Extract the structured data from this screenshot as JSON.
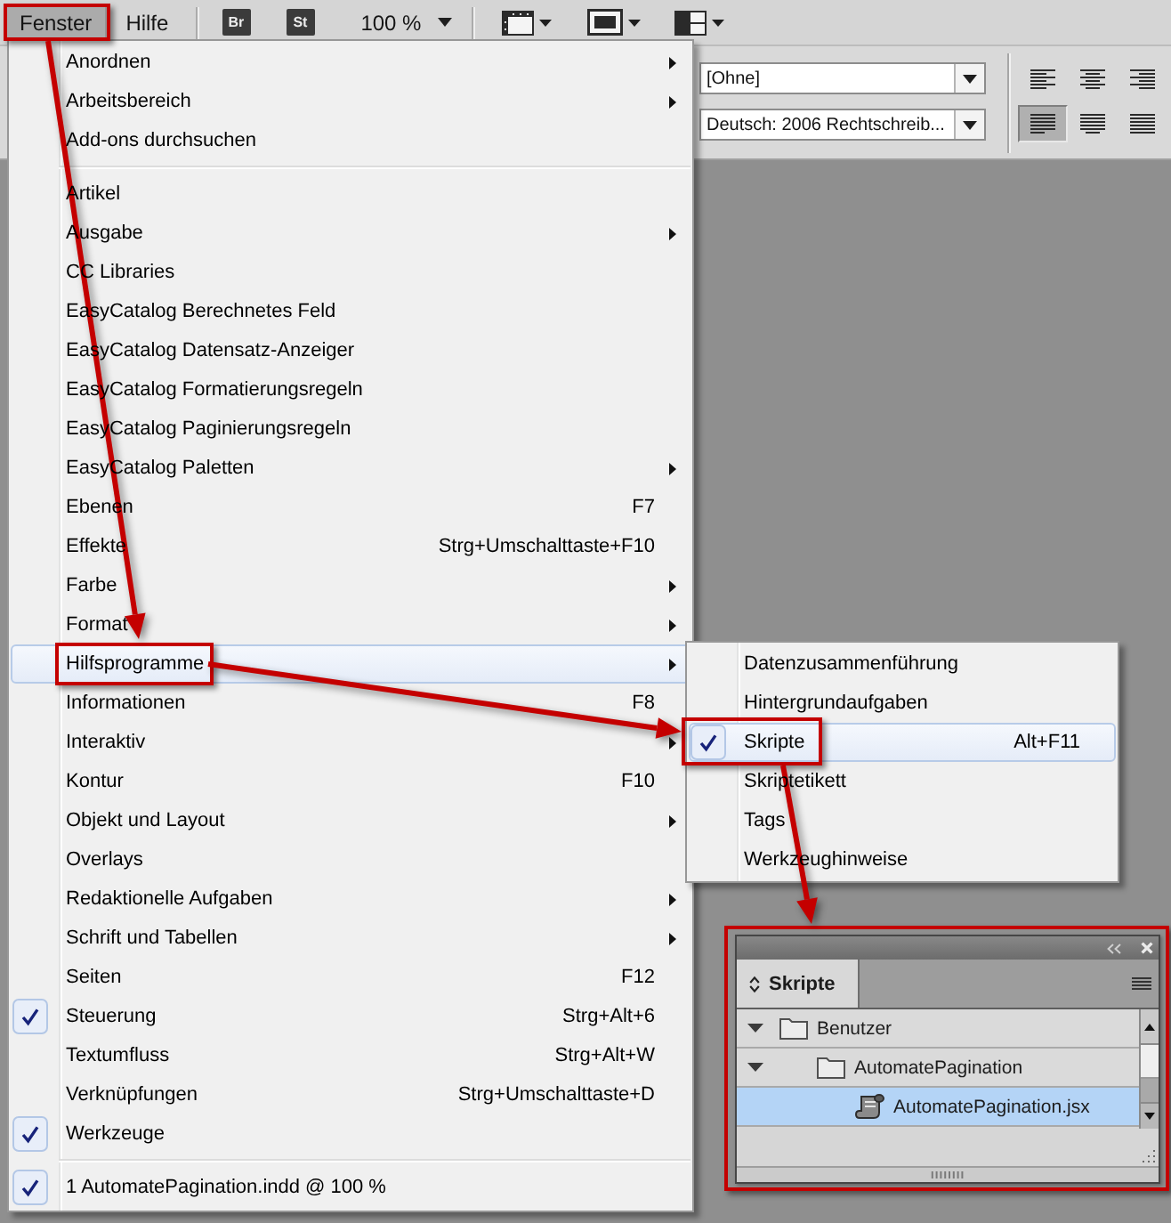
{
  "menu_bar": {
    "items": [
      {
        "label": "Fenster",
        "selected": true,
        "callout": true
      },
      {
        "label": "Hilfe",
        "selected": false,
        "callout": false
      }
    ],
    "app_buttons": [
      "Br",
      "St"
    ],
    "zoom": "100 %"
  },
  "control_panel": {
    "dropdowns": [
      "[Ohne]",
      "Deutsch: 2006 Rechtschreib..."
    ],
    "alignment_buttons": [
      {
        "kind": "align-left",
        "selected": false
      },
      {
        "kind": "align-center",
        "selected": false
      },
      {
        "kind": "align-right",
        "selected": false
      },
      {
        "kind": "justify-left",
        "selected": true
      },
      {
        "kind": "justify-center",
        "selected": false
      },
      {
        "kind": "justify-all",
        "selected": false
      }
    ]
  },
  "window_menu": {
    "items": [
      {
        "kind": "item",
        "label": "Anordnen",
        "submenu": true,
        "checked": false,
        "selected": false,
        "callout": false
      },
      {
        "kind": "item",
        "label": "Arbeitsbereich",
        "submenu": true,
        "checked": false,
        "selected": false,
        "callout": false
      },
      {
        "kind": "item",
        "label": "Add-ons durchsuchen",
        "submenu": false,
        "checked": false,
        "selected": false,
        "callout": false
      },
      {
        "kind": "separator"
      },
      {
        "kind": "item",
        "label": "Artikel",
        "submenu": false,
        "checked": false,
        "selected": false,
        "callout": false
      },
      {
        "kind": "item",
        "label": "Ausgabe",
        "submenu": true,
        "checked": false,
        "selected": false,
        "callout": false
      },
      {
        "kind": "item",
        "label": "CC Libraries",
        "submenu": false,
        "checked": false,
        "selected": false,
        "callout": false
      },
      {
        "kind": "item",
        "label": "EasyCatalog Berechnetes Feld",
        "submenu": false,
        "checked": false,
        "selected": false,
        "callout": false
      },
      {
        "kind": "item",
        "label": "EasyCatalog Datensatz-Anzeiger",
        "submenu": false,
        "checked": false,
        "selected": false,
        "callout": false
      },
      {
        "kind": "item",
        "label": "EasyCatalog Formatierungsregeln",
        "submenu": false,
        "checked": false,
        "selected": false,
        "callout": false
      },
      {
        "kind": "item",
        "label": "EasyCatalog Paginierungsregeln",
        "submenu": false,
        "checked": false,
        "selected": false,
        "callout": false
      },
      {
        "kind": "item",
        "label": "EasyCatalog Paletten",
        "submenu": true,
        "checked": false,
        "selected": false,
        "callout": false
      },
      {
        "kind": "item",
        "label": "Ebenen",
        "shortcut": "F7",
        "submenu": false,
        "checked": false,
        "selected": false,
        "callout": false
      },
      {
        "kind": "item",
        "label": "Effekte",
        "shortcut": "Strg+Umschalttaste+F10",
        "submenu": false,
        "checked": false,
        "selected": false,
        "callout": false
      },
      {
        "kind": "item",
        "label": "Farbe",
        "submenu": true,
        "checked": false,
        "selected": false,
        "callout": false
      },
      {
        "kind": "item",
        "label": "Format",
        "submenu": true,
        "checked": false,
        "selected": false,
        "callout": false
      },
      {
        "kind": "item",
        "label": "Hilfsprogramme",
        "submenu": true,
        "checked": false,
        "selected": true,
        "callout": true
      },
      {
        "kind": "item",
        "label": "Informationen",
        "shortcut": "F8",
        "submenu": false,
        "checked": false,
        "selected": false,
        "callout": false
      },
      {
        "kind": "item",
        "label": "Interaktiv",
        "submenu": true,
        "checked": false,
        "selected": false,
        "callout": false
      },
      {
        "kind": "item",
        "label": "Kontur",
        "shortcut": "F10",
        "submenu": false,
        "checked": false,
        "selected": false,
        "callout": false
      },
      {
        "kind": "item",
        "label": "Objekt und Layout",
        "submenu": true,
        "checked": false,
        "selected": false,
        "callout": false
      },
      {
        "kind": "item",
        "label": "Overlays",
        "submenu": false,
        "checked": false,
        "selected": false,
        "callout": false
      },
      {
        "kind": "item",
        "label": "Redaktionelle Aufgaben",
        "submenu": true,
        "checked": false,
        "selected": false,
        "callout": false
      },
      {
        "kind": "item",
        "label": "Schrift und Tabellen",
        "submenu": true,
        "checked": false,
        "selected": false,
        "callout": false
      },
      {
        "kind": "item",
        "label": "Seiten",
        "shortcut": "F12",
        "submenu": false,
        "checked": false,
        "selected": false,
        "callout": false
      },
      {
        "kind": "item",
        "label": "Steuerung",
        "shortcut": "Strg+Alt+6",
        "submenu": false,
        "checked": true,
        "selected": false,
        "callout": false
      },
      {
        "kind": "item",
        "label": "Textumfluss",
        "shortcut": "Strg+Alt+W",
        "submenu": false,
        "checked": false,
        "selected": false,
        "callout": false
      },
      {
        "kind": "item",
        "label": "Verknüpfungen",
        "shortcut": "Strg+Umschalttaste+D",
        "submenu": false,
        "checked": false,
        "selected": false,
        "callout": false
      },
      {
        "kind": "item",
        "label": "Werkzeuge",
        "submenu": false,
        "checked": true,
        "selected": false,
        "callout": false
      },
      {
        "kind": "separator"
      },
      {
        "kind": "item",
        "label": "1 AutomatePagination.indd @ 100 %",
        "submenu": false,
        "checked": true,
        "selected": false,
        "callout": false
      }
    ]
  },
  "utilities_submenu": {
    "items": [
      {
        "kind": "item",
        "label": "Datenzusammenführung",
        "checked": false,
        "selected": false,
        "callout": false
      },
      {
        "kind": "item",
        "label": "Hintergrundaufgaben",
        "checked": false,
        "selected": false,
        "callout": false
      },
      {
        "kind": "item",
        "label": "Skripte",
        "shortcut": "Alt+F11",
        "checked": true,
        "selected": true,
        "callout": true
      },
      {
        "kind": "item",
        "label": "Skriptetikett",
        "checked": false,
        "selected": false,
        "callout": false
      },
      {
        "kind": "item",
        "label": "Tags",
        "checked": false,
        "selected": false,
        "callout": false
      },
      {
        "kind": "item",
        "label": "Werkzeughinweise",
        "checked": false,
        "selected": false,
        "callout": false
      }
    ]
  },
  "scripts_panel": {
    "callout": true,
    "tabs": [
      {
        "label": "Skripte",
        "selected": true
      }
    ],
    "tree": [
      {
        "kind": "folder",
        "label": "Benutzer",
        "expanded": true,
        "selected": false,
        "children": [
          {
            "kind": "folder",
            "label": "AutomatePagination",
            "expanded": true,
            "selected": false,
            "children": [
              {
                "kind": "script",
                "label": "AutomatePagination.jsx",
                "selected": true
              }
            ]
          }
        ]
      }
    ]
  }
}
